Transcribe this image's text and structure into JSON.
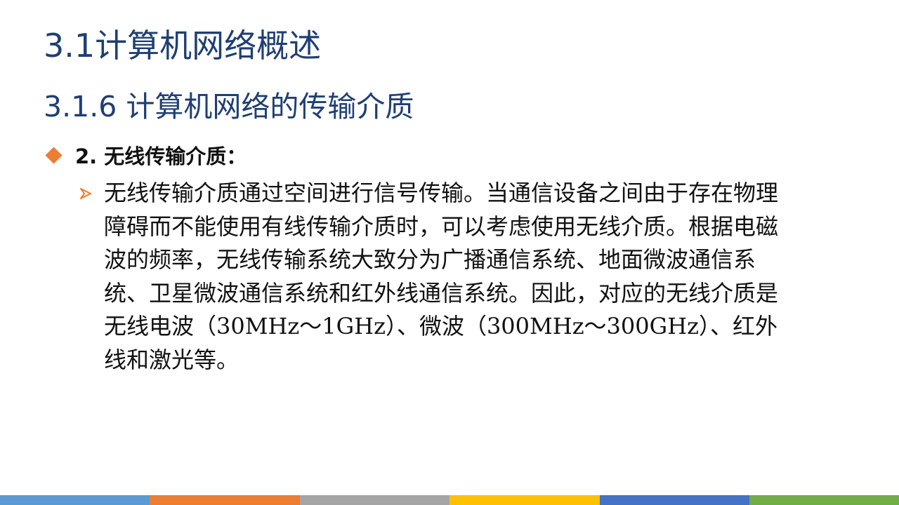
{
  "slide": {
    "title": "3.1计算机网络概述",
    "subtitle": "3.1.6 计算机网络的传输介质",
    "bullet_level1": {
      "icon": "orange-diamond-bullet-icon",
      "text": "2. 无线传输介质："
    },
    "bullet_level2": {
      "icon": "orange-arrow-bullet-icon",
      "text": "无线传输介质通过空间进行信号传输。当通信设备之间由于存在物理障碍而不能使用有线传输介质时，可以考虑使用无线介质。根据电磁波的频率，无线传输系统大致分为广播通信系统、地面微波通信系统、卫星微波通信系统和红外线通信系统。因此，对应的无线介质是无线电波（30MHz～1GHz）、微波（300MHz～300GHz）、红外线和激光等。"
    }
  },
  "colors": {
    "title": "#1f3f74",
    "accent": "#ed7d31",
    "footer_segments": [
      "#5b9bd5",
      "#ed7d31",
      "#a5a5a5",
      "#ffc000",
      "#4472c4",
      "#70ad47"
    ]
  }
}
